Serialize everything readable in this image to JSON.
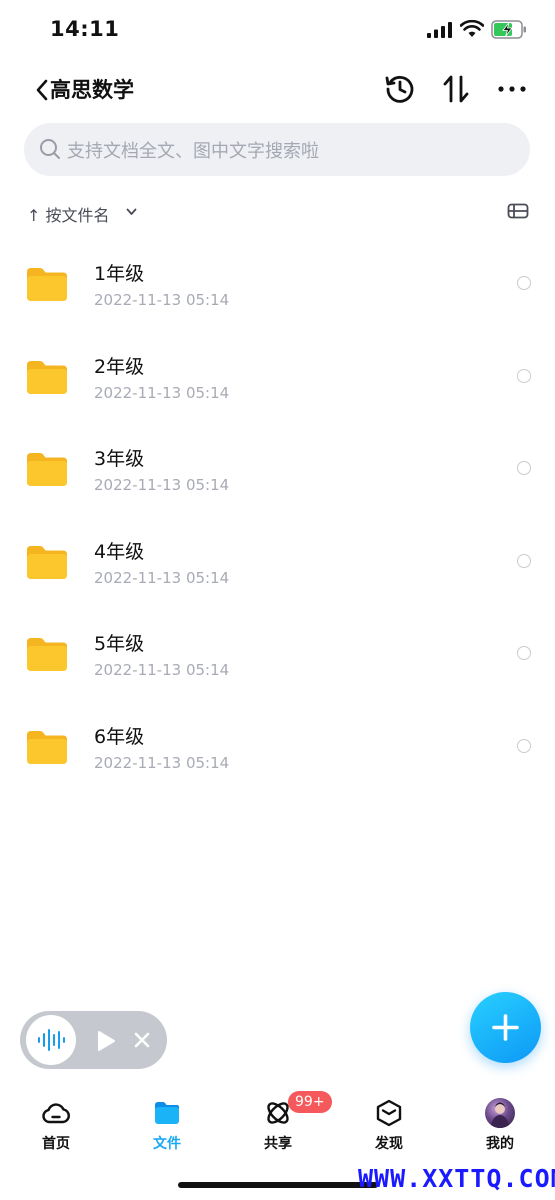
{
  "status_bar": {
    "time": "14:11"
  },
  "nav": {
    "title": "高思数学"
  },
  "search": {
    "placeholder": "支持文档全文、图中文字搜索啦"
  },
  "sort": {
    "label": "↑ 按文件名"
  },
  "files": [
    {
      "name": "1年级",
      "date": "2022-11-13 05:14"
    },
    {
      "name": "2年级",
      "date": "2022-11-13 05:14"
    },
    {
      "name": "3年级",
      "date": "2022-11-13 05:14"
    },
    {
      "name": "4年级",
      "date": "2022-11-13 05:14"
    },
    {
      "name": "5年级",
      "date": "2022-11-13 05:14"
    },
    {
      "name": "6年级",
      "date": "2022-11-13 05:14"
    }
  ],
  "tabs": [
    {
      "label": "首页",
      "icon": "cloud-icon",
      "active": false
    },
    {
      "label": "文件",
      "icon": "folder-icon",
      "active": true
    },
    {
      "label": "共享",
      "icon": "share-orbit-icon",
      "active": false
    },
    {
      "label": "发现",
      "icon": "cube-icon",
      "active": false
    },
    {
      "label": "我的",
      "icon": "avatar",
      "active": false
    }
  ],
  "share_badge": "99+",
  "watermark": "WWW.XXTTQ.COM",
  "colors": {
    "accent": "#18a8f5",
    "folder": "#fcc62d",
    "badge": "#f5595b"
  }
}
